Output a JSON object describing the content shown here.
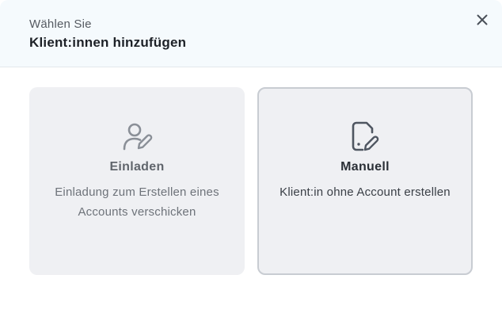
{
  "dialog": {
    "subtitle": "Wählen Sie",
    "title": "Klient:innen hinzufügen",
    "close_icon": "close-icon"
  },
  "options": {
    "invite": {
      "icon": "user-pen-icon",
      "title": "Einladen",
      "description": "Einladung zum Erstellen eines Accounts verschicken"
    },
    "manual": {
      "icon": "document-pen-icon",
      "title": "Manuell",
      "description": "Klient:in ohne Account erstellen",
      "selected": true
    }
  },
  "colors": {
    "header_bg": "#f5fafd",
    "card_bg": "#eff0f3",
    "selected_border": "#c8ccd2",
    "icon_color": "#4f5661"
  }
}
